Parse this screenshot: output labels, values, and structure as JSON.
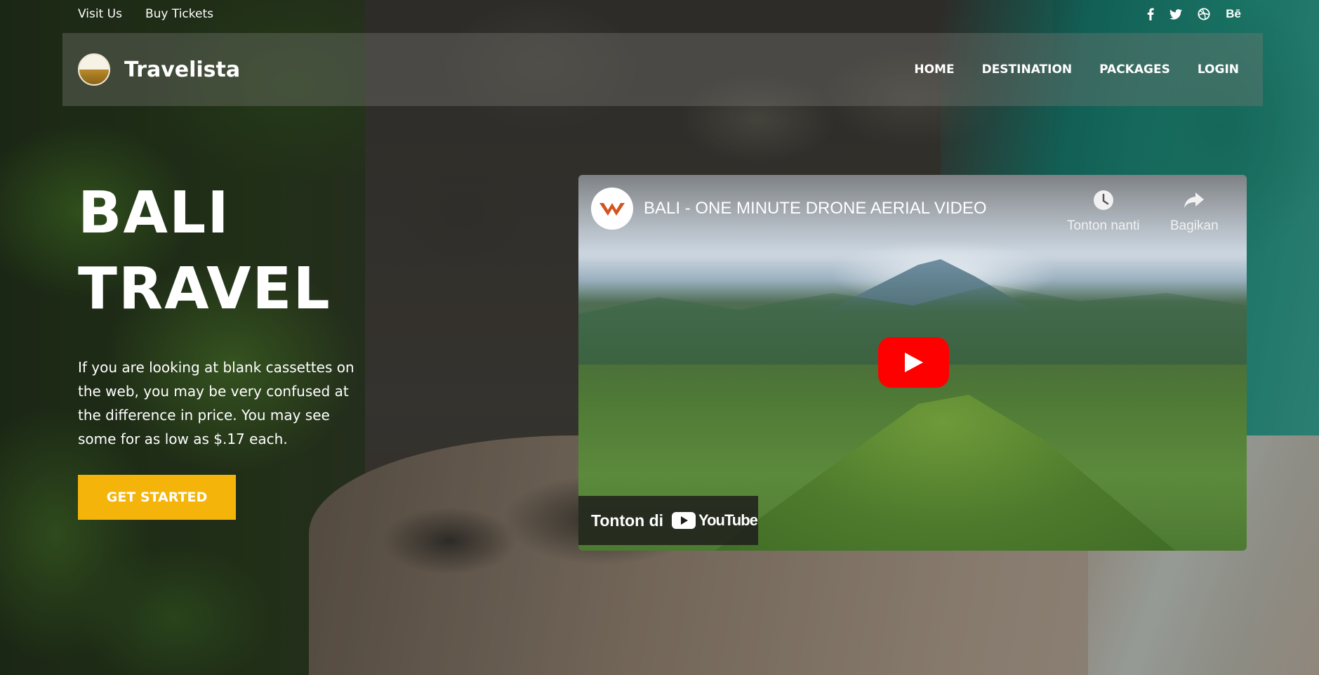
{
  "topbar": {
    "links": [
      "Visit Us",
      "Buy Tickets"
    ],
    "social": [
      {
        "name": "facebook-icon",
        "glyph": "f"
      },
      {
        "name": "twitter-icon",
        "glyph": ""
      },
      {
        "name": "dribbble-icon",
        "glyph": ""
      },
      {
        "name": "behance-icon",
        "glyph": "Bē"
      }
    ]
  },
  "navbar": {
    "brand": "Travelista",
    "menu": [
      "HOME",
      "DESTINATION",
      "PACKAGES",
      "LOGIN"
    ]
  },
  "hero": {
    "title_line1": "BALI",
    "title_line2": "TRAVEL",
    "description": "If you are looking at blank cassettes on the web, you may be very confused at the difference in price. You may see some for as low as $.17 each.",
    "cta": "GET STARTED"
  },
  "video": {
    "title": "BALI - ONE MINUTE DRONE AERIAL VIDEO",
    "watch_later": "Tonton nanti",
    "share": "Bagikan",
    "watch_on": "Tonton di",
    "platform": "YouTube"
  },
  "colors": {
    "accent": "#f5b40a",
    "youtube_red": "#ff0000",
    "channel_logo": "#d4531f"
  }
}
